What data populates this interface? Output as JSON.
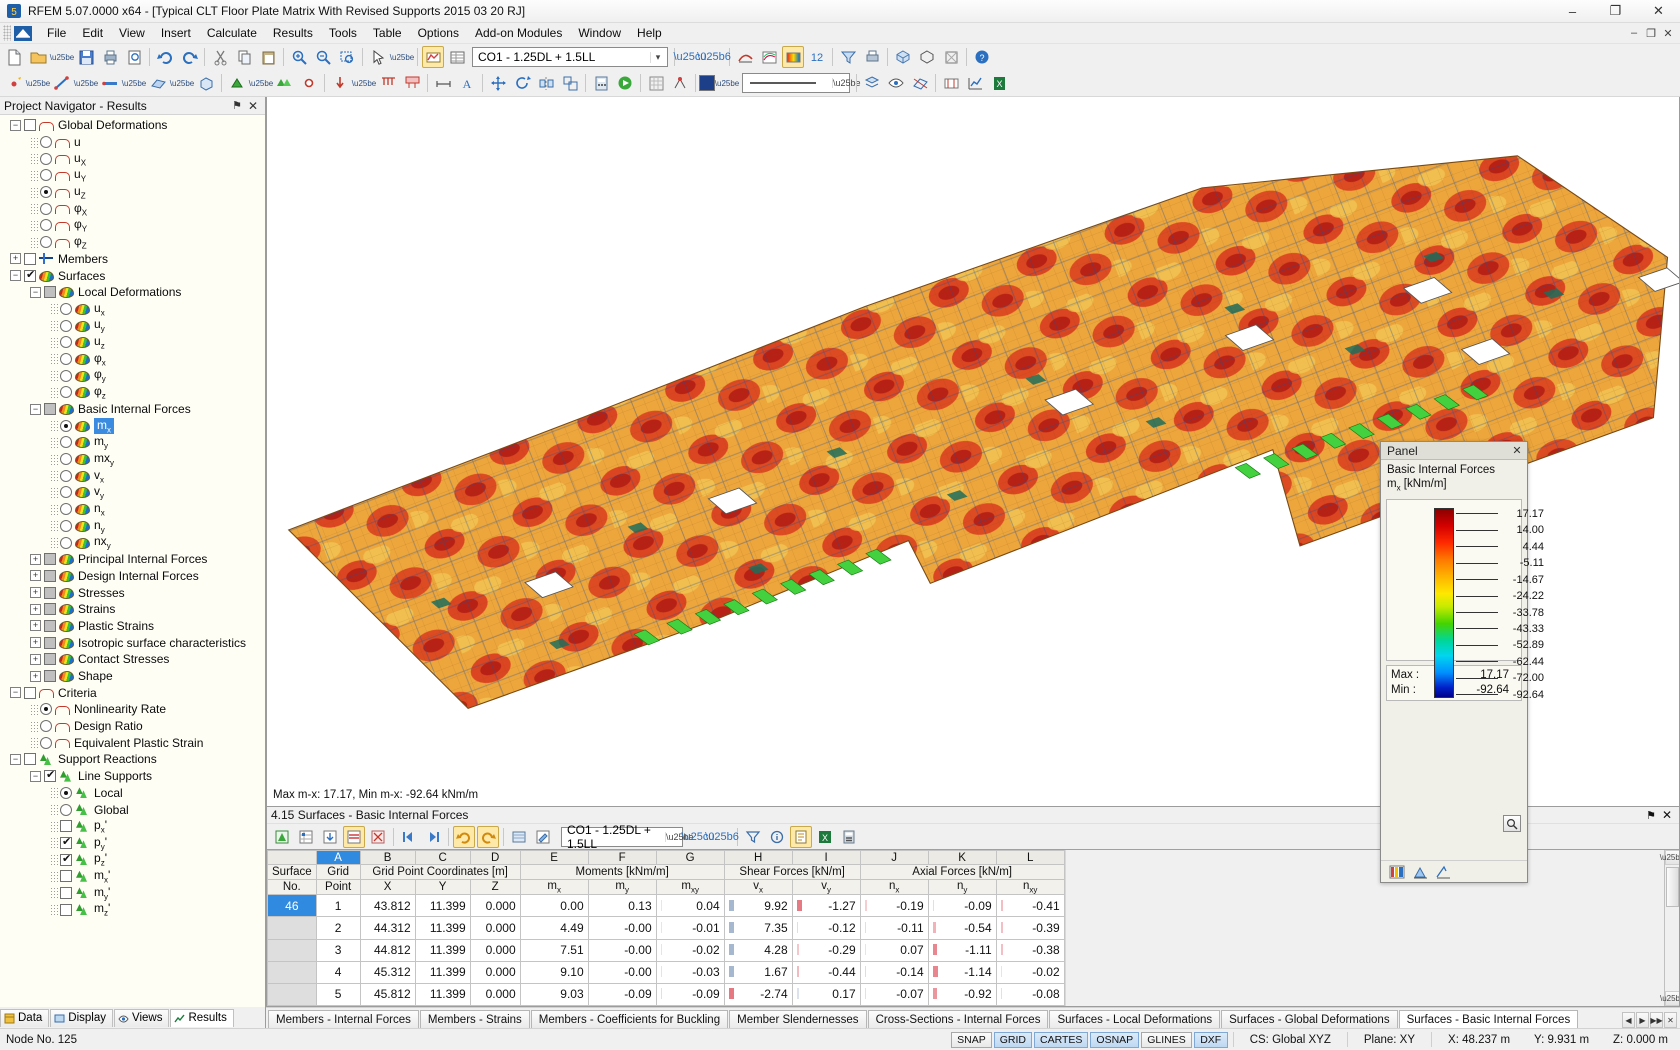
{
  "window": {
    "title": "RFEM 5.07.0000 x64 - [Typical CLT Floor Plate Matrix With Revised Supports 2015 03 20 RJ]",
    "minimize": "–",
    "maximize": "❐",
    "close": "✕",
    "mdi_minimize": "–",
    "mdi_restore": "❐",
    "mdi_close": "✕"
  },
  "menu": {
    "items": [
      {
        "label": "File"
      },
      {
        "label": "Edit"
      },
      {
        "label": "View"
      },
      {
        "label": "Insert"
      },
      {
        "label": "Calculate"
      },
      {
        "label": "Results"
      },
      {
        "label": "Tools"
      },
      {
        "label": "Table"
      },
      {
        "label": "Options"
      },
      {
        "label": "Add-on Modules"
      },
      {
        "label": "Window"
      },
      {
        "label": "Help"
      }
    ]
  },
  "toolbar": {
    "load_case": "CO1 - 1.25DL + 1.5LL",
    "dropdown_arrow": "▾"
  },
  "navigator": {
    "title": "Project Navigator - Results",
    "pin": "⚑",
    "close": "✕",
    "tree": [
      {
        "depth": 0,
        "label": "Global Deformations",
        "ctrl": "expander-minus",
        "box": "checkbox",
        "state": "unchecked",
        "icon": "deformation-icon"
      },
      {
        "depth": 1,
        "label": "u",
        "ctrl": "none",
        "box": "radio",
        "state": "off",
        "icon": "deformation-icon"
      },
      {
        "depth": 1,
        "label": "uX",
        "ctrl": "none",
        "box": "radio",
        "state": "off",
        "icon": "deformation-icon"
      },
      {
        "depth": 1,
        "label": "uY",
        "ctrl": "none",
        "box": "radio",
        "state": "off",
        "icon": "deformation-icon"
      },
      {
        "depth": 1,
        "label": "uZ",
        "ctrl": "none",
        "box": "radio",
        "state": "on",
        "icon": "deformation-icon"
      },
      {
        "depth": 1,
        "label": "φX",
        "ctrl": "none",
        "box": "radio",
        "state": "off",
        "icon": "deformation-icon"
      },
      {
        "depth": 1,
        "label": "φY",
        "ctrl": "none",
        "box": "radio",
        "state": "off",
        "icon": "deformation-icon"
      },
      {
        "depth": 1,
        "label": "φZ",
        "ctrl": "none",
        "box": "radio",
        "state": "off",
        "icon": "deformation-icon"
      },
      {
        "depth": 0,
        "label": "Members",
        "ctrl": "expander-plus",
        "box": "checkbox",
        "state": "unchecked",
        "icon": "member-icon"
      },
      {
        "depth": 0,
        "label": "Surfaces",
        "ctrl": "expander-minus",
        "box": "checkbox",
        "state": "checked",
        "icon": "surface-icon"
      },
      {
        "depth": 1,
        "label": "Local Deformations",
        "ctrl": "expander-minus",
        "box": "checkbox",
        "state": "gray",
        "icon": "surface-icon"
      },
      {
        "depth": 2,
        "label": "ux",
        "ctrl": "none",
        "box": "radio",
        "state": "off",
        "icon": "surface-icon"
      },
      {
        "depth": 2,
        "label": "uy",
        "ctrl": "none",
        "box": "radio",
        "state": "off",
        "icon": "surface-icon"
      },
      {
        "depth": 2,
        "label": "uz",
        "ctrl": "none",
        "box": "radio",
        "state": "off",
        "icon": "surface-icon"
      },
      {
        "depth": 2,
        "label": "φx",
        "ctrl": "none",
        "box": "radio",
        "state": "off",
        "icon": "surface-icon"
      },
      {
        "depth": 2,
        "label": "φy",
        "ctrl": "none",
        "box": "radio",
        "state": "off",
        "icon": "surface-icon"
      },
      {
        "depth": 2,
        "label": "φz",
        "ctrl": "none",
        "box": "radio",
        "state": "off",
        "icon": "surface-icon"
      },
      {
        "depth": 1,
        "label": "Basic Internal Forces",
        "ctrl": "expander-minus",
        "box": "checkbox",
        "state": "gray",
        "icon": "surface-icon"
      },
      {
        "depth": 2,
        "label": "mx",
        "ctrl": "none",
        "box": "radio",
        "state": "on",
        "icon": "surface-icon",
        "selected": true
      },
      {
        "depth": 2,
        "label": "my",
        "ctrl": "none",
        "box": "radio",
        "state": "off",
        "icon": "surface-icon"
      },
      {
        "depth": 2,
        "label": "mxy",
        "ctrl": "none",
        "box": "radio",
        "state": "off",
        "icon": "surface-icon"
      },
      {
        "depth": 2,
        "label": "vx",
        "ctrl": "none",
        "box": "radio",
        "state": "off",
        "icon": "surface-icon"
      },
      {
        "depth": 2,
        "label": "vy",
        "ctrl": "none",
        "box": "radio",
        "state": "off",
        "icon": "surface-icon"
      },
      {
        "depth": 2,
        "label": "nx",
        "ctrl": "none",
        "box": "radio",
        "state": "off",
        "icon": "surface-icon"
      },
      {
        "depth": 2,
        "label": "ny",
        "ctrl": "none",
        "box": "radio",
        "state": "off",
        "icon": "surface-icon"
      },
      {
        "depth": 2,
        "label": "nxy",
        "ctrl": "none",
        "box": "radio",
        "state": "off",
        "icon": "surface-icon"
      },
      {
        "depth": 1,
        "label": "Principal Internal Forces",
        "ctrl": "expander-plus",
        "box": "checkbox",
        "state": "gray",
        "icon": "surface-icon"
      },
      {
        "depth": 1,
        "label": "Design Internal Forces",
        "ctrl": "expander-plus",
        "box": "checkbox",
        "state": "gray",
        "icon": "surface-icon"
      },
      {
        "depth": 1,
        "label": "Stresses",
        "ctrl": "expander-plus",
        "box": "checkbox",
        "state": "gray",
        "icon": "surface-icon"
      },
      {
        "depth": 1,
        "label": "Strains",
        "ctrl": "expander-plus",
        "box": "checkbox",
        "state": "gray",
        "icon": "surface-icon"
      },
      {
        "depth": 1,
        "label": "Plastic Strains",
        "ctrl": "expander-plus",
        "box": "checkbox",
        "state": "gray",
        "icon": "surface-icon"
      },
      {
        "depth": 1,
        "label": "Isotropic surface characteristics",
        "ctrl": "expander-plus",
        "box": "checkbox",
        "state": "gray",
        "icon": "surface-icon"
      },
      {
        "depth": 1,
        "label": "Contact Stresses",
        "ctrl": "expander-plus",
        "box": "checkbox",
        "state": "gray",
        "icon": "surface-icon"
      },
      {
        "depth": 1,
        "label": "Shape",
        "ctrl": "expander-plus",
        "box": "checkbox",
        "state": "gray",
        "icon": "surface-icon"
      },
      {
        "depth": 0,
        "label": "Criteria",
        "ctrl": "expander-minus",
        "box": "checkbox",
        "state": "unchecked",
        "icon": "deformation-icon"
      },
      {
        "depth": 1,
        "label": "Nonlinearity Rate",
        "ctrl": "none",
        "box": "radio",
        "state": "on",
        "icon": "deformation-icon"
      },
      {
        "depth": 1,
        "label": "Design Ratio",
        "ctrl": "none",
        "box": "radio",
        "state": "off",
        "icon": "deformation-icon"
      },
      {
        "depth": 1,
        "label": "Equivalent Plastic Strain",
        "ctrl": "none",
        "box": "radio",
        "state": "off",
        "icon": "deformation-icon"
      },
      {
        "depth": 0,
        "label": "Support Reactions",
        "ctrl": "expander-minus",
        "box": "checkbox",
        "state": "unchecked",
        "icon": "support-icon"
      },
      {
        "depth": 1,
        "label": "Line Supports",
        "ctrl": "expander-minus",
        "box": "checkbox",
        "state": "checked",
        "icon": "support-icon"
      },
      {
        "depth": 2,
        "label": "Local",
        "ctrl": "none",
        "box": "radio",
        "state": "on",
        "icon": "support-icon"
      },
      {
        "depth": 2,
        "label": "Global",
        "ctrl": "none",
        "box": "radio",
        "state": "off",
        "icon": "support-icon"
      },
      {
        "depth": 2,
        "label": "px'",
        "ctrl": "none",
        "box": "checkbox",
        "state": "unchecked",
        "icon": "support-icon"
      },
      {
        "depth": 2,
        "label": "py'",
        "ctrl": "none",
        "box": "checkbox",
        "state": "checked",
        "icon": "support-icon"
      },
      {
        "depth": 2,
        "label": "pz'",
        "ctrl": "none",
        "box": "checkbox",
        "state": "checked",
        "icon": "support-icon"
      },
      {
        "depth": 2,
        "label": "mx'",
        "ctrl": "none",
        "box": "checkbox",
        "state": "unchecked",
        "icon": "support-icon"
      },
      {
        "depth": 2,
        "label": "my'",
        "ctrl": "none",
        "box": "checkbox",
        "state": "unchecked",
        "icon": "support-icon"
      },
      {
        "depth": 2,
        "label": "mz'",
        "ctrl": "none",
        "box": "checkbox",
        "state": "unchecked",
        "icon": "support-icon"
      }
    ]
  },
  "viewport": {
    "maxmin_text": "Max m-x: 17.17, Min m-x: -92.64 kNm/m"
  },
  "panel": {
    "title": "Panel",
    "close": "✕",
    "heading": "Basic Internal Forces",
    "quantity": "m",
    "quantity_sub": "x",
    "unit": " [kNm/m]",
    "legend_values": [
      "17.17",
      "14.00",
      "4.44",
      "-5.11",
      "-14.67",
      "-24.22",
      "-33.78",
      "-43.33",
      "-52.89",
      "-62.44",
      "-72.00",
      "-92.64"
    ],
    "max_label": "Max :",
    "max_value": "17.17",
    "min_label": "Min :",
    "min_value": "-92.64",
    "zoom_icon": "magnifier-icon"
  },
  "table": {
    "title": "4.15 Surfaces - Basic Internal Forces",
    "pin": "⚑",
    "close": "✕",
    "load_case": "CO1 - 1.25DL + 1.5LL",
    "column_letters": [
      "A",
      "B",
      "C",
      "D",
      "E",
      "F",
      "G",
      "H",
      "I",
      "J",
      "K",
      "L"
    ],
    "selected_column": "A",
    "group_headers": [
      {
        "label": "Surface",
        "span": 1
      },
      {
        "label": "Grid",
        "span": 1
      },
      {
        "label": "Grid Point Coordinates [m]",
        "span": 3
      },
      {
        "label": "Moments [kNm/m]",
        "span": 3
      },
      {
        "label": "Shear Forces [kN/m]",
        "span": 2
      },
      {
        "label": "Axial Forces [kN/m]",
        "span": 3
      }
    ],
    "sub_headers": [
      {
        "t": "No.",
        "s": ""
      },
      {
        "t": "Point",
        "s": ""
      },
      {
        "t": "X",
        "s": ""
      },
      {
        "t": "Y",
        "s": ""
      },
      {
        "t": "Z",
        "s": ""
      },
      {
        "t": "m",
        "s": "x"
      },
      {
        "t": "m",
        "s": "y"
      },
      {
        "t": "m",
        "s": "xy"
      },
      {
        "t": "v",
        "s": "x"
      },
      {
        "t": "v",
        "s": "y"
      },
      {
        "t": "n",
        "s": "x"
      },
      {
        "t": "n",
        "s": "y"
      },
      {
        "t": "n",
        "s": "xy"
      }
    ],
    "rows": [
      {
        "surface": "46",
        "surface_selected": true,
        "point": "1",
        "x": "43.812",
        "y": "11.399",
        "z": "0.000",
        "mx": "0.00",
        "my": "0.13",
        "mxy": "0.04",
        "vx": "9.92",
        "vy": "-1.27",
        "nx": "-0.19",
        "ny": "-0.09",
        "nxy": "-0.41"
      },
      {
        "surface": "",
        "surface_selected": false,
        "point": "2",
        "x": "44.312",
        "y": "11.399",
        "z": "0.000",
        "mx": "4.49",
        "my": "-0.00",
        "mxy": "-0.01",
        "vx": "7.35",
        "vy": "-0.12",
        "nx": "-0.11",
        "ny": "-0.54",
        "nxy": "-0.39"
      },
      {
        "surface": "",
        "surface_selected": false,
        "point": "3",
        "x": "44.812",
        "y": "11.399",
        "z": "0.000",
        "mx": "7.51",
        "my": "-0.00",
        "mxy": "-0.02",
        "vx": "4.28",
        "vy": "-0.29",
        "nx": "0.07",
        "ny": "-1.11",
        "nxy": "-0.38"
      },
      {
        "surface": "",
        "surface_selected": false,
        "point": "4",
        "x": "45.312",
        "y": "11.399",
        "z": "0.000",
        "mx": "9.10",
        "my": "-0.00",
        "mxy": "-0.03",
        "vx": "1.67",
        "vy": "-0.44",
        "nx": "-0.14",
        "ny": "-1.14",
        "nxy": "-0.02"
      },
      {
        "surface": "",
        "surface_selected": false,
        "point": "5",
        "x": "45.812",
        "y": "11.399",
        "z": "0.000",
        "mx": "9.03",
        "my": "-0.09",
        "mxy": "-0.09",
        "vx": "-2.74",
        "vy": "0.17",
        "nx": "-0.07",
        "ny": "-0.92",
        "nxy": "-0.08"
      }
    ]
  },
  "tabs": {
    "items": [
      {
        "label": "Members - Internal Forces",
        "active": false
      },
      {
        "label": "Members - Strains",
        "active": false
      },
      {
        "label": "Members - Coefficients for Buckling",
        "active": false
      },
      {
        "label": "Member Slendernesses",
        "active": false
      },
      {
        "label": "Cross-Sections - Internal Forces",
        "active": false
      },
      {
        "label": "Surfaces - Local Deformations",
        "active": false
      },
      {
        "label": "Surfaces - Global Deformations",
        "active": false
      },
      {
        "label": "Surfaces - Basic Internal Forces",
        "active": true
      }
    ],
    "nav": [
      "◀",
      "▶",
      "▶▶",
      "✕"
    ]
  },
  "leftstrip": {
    "items": [
      {
        "label": "Data",
        "active": false,
        "icon": "data-icon"
      },
      {
        "label": "Display",
        "active": false,
        "icon": "display-icon"
      },
      {
        "label": "Views",
        "active": false,
        "icon": "views-icon"
      },
      {
        "label": "Results",
        "active": true,
        "icon": "results-icon"
      }
    ]
  },
  "status": {
    "left": "Node No. 125",
    "chips": [
      {
        "label": "SNAP",
        "on": false
      },
      {
        "label": "GRID",
        "on": true
      },
      {
        "label": "CARTES",
        "on": true
      },
      {
        "label": "OSNAP",
        "on": true
      },
      {
        "label": "GLINES",
        "on": false
      },
      {
        "label": "DXF",
        "on": true
      }
    ],
    "cs": "CS: Global XYZ",
    "plane": "Plane: XY",
    "x": "X: 48.237 m",
    "y": "Y: 9.931 m",
    "z": "Z: 0.000 m"
  },
  "colors": {
    "accent": "#2f8ae0",
    "selection": "#3b8ce0",
    "panel_bg": "#f0efe8",
    "sidebar_bg": "#fffef5"
  }
}
